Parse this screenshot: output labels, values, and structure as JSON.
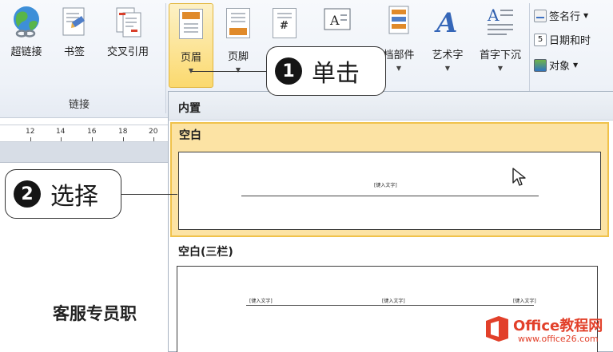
{
  "ribbon": {
    "links_group": {
      "label": "链接",
      "buttons": [
        {
          "label": "超链接",
          "icon": "globe-link-icon"
        },
        {
          "label": "书签",
          "icon": "bookmark-icon"
        },
        {
          "label": "交叉引用",
          "icon": "cross-reference-icon"
        }
      ]
    },
    "header_footer_group": {
      "buttons": [
        {
          "label": "页眉",
          "icon": "header-icon",
          "state": "active"
        },
        {
          "label": "页脚",
          "icon": "footer-icon"
        },
        {
          "label": "",
          "icon": "page-number-icon"
        }
      ]
    },
    "text_group": {
      "buttons": [
        {
          "label": "",
          "icon": "text-box-icon"
        },
        {
          "label": "档部件",
          "icon": "quick-parts-icon"
        },
        {
          "label": "艺术字",
          "icon": "wordart-icon"
        },
        {
          "label": "首字下沉",
          "icon": "drop-cap-icon"
        }
      ],
      "small_commands": [
        {
          "label": "签名行",
          "icon": "signature-line-icon"
        },
        {
          "label": "日期和时",
          "icon": "date-time-icon"
        },
        {
          "label": "对象",
          "icon": "object-icon"
        }
      ]
    }
  },
  "ruler": {
    "ticks": [
      "12",
      "14",
      "16",
      "18",
      "20"
    ]
  },
  "document": {
    "title": "客服专员职"
  },
  "gallery": {
    "heading": "内置",
    "items": [
      {
        "name": "空白",
        "placeholder": "[键入文字]",
        "state": "selected"
      },
      {
        "name": "空白(三栏)",
        "placeholders": [
          "[键入文字]",
          "[键入文字]",
          "[键入文字]"
        ]
      }
    ]
  },
  "callouts": [
    {
      "number": "1",
      "text": "单击"
    },
    {
      "number": "2",
      "text": "选择"
    }
  ],
  "watermark": {
    "line1": "Office教程网",
    "line2": "www.office26.com"
  },
  "colors": {
    "accent": "#fbd96e",
    "selected_bg": "#fce3a4",
    "watermark": "#e2402a"
  }
}
